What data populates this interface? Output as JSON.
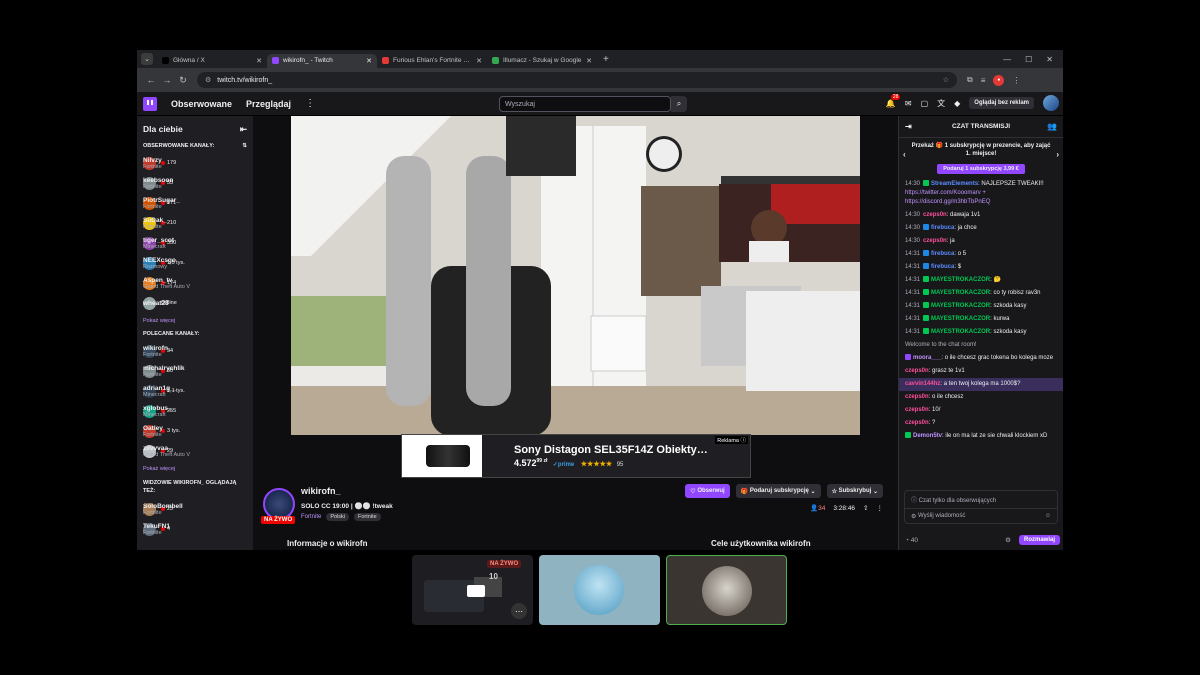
{
  "browser": {
    "tabs": [
      {
        "title": "Główna / X",
        "fav": "#000000",
        "active": false
      },
      {
        "title": "wikirofn_ - Twitch",
        "fav": "#9146ff",
        "active": true
      },
      {
        "title": "Furious Ehlan's Fortnite Stats -",
        "fav": "#e53935",
        "active": false
      },
      {
        "title": "Illumacz - Szukaj w Google",
        "fav": "#34a853",
        "active": false
      }
    ],
    "url": "twitch.tv/wikirofn_"
  },
  "nav": {
    "following": "Obserwowane",
    "browse": "Przeglądaj",
    "search_placeholder": "Wyszukaj",
    "notif_count": "28",
    "ad_free": "Oglądaj bez reklam"
  },
  "sidebar": {
    "title": "Dla ciebie",
    "followed_title": "OBSERWOWANE KANAŁY:",
    "followed": [
      {
        "name": "Nilvzy",
        "game": "Fortnite",
        "viewers": "179",
        "color": "#c0392b"
      },
      {
        "name": "keebsoon",
        "game": "Fortnite",
        "viewers": "55",
        "color": "#7f8c8d"
      },
      {
        "name": "PiotrSugar_",
        "game": "Fortnite",
        "viewers": "171",
        "color": "#d35400"
      },
      {
        "name": "SuDak_",
        "game": "Fortnite",
        "viewers": "210",
        "color": "#f1c40f"
      },
      {
        "name": "tiger_scot",
        "game": "Minecraft",
        "viewers": "350",
        "color": "#8e44ad"
      },
      {
        "name": "NEEXcsgo",
        "game": "Rozmowy",
        "viewers": "1,5 tys.",
        "color": "#2980b9"
      },
      {
        "name": "Aspen_tv_",
        "game": "Grand Theft Auto V",
        "viewers": "174",
        "color": "#e67e22"
      },
      {
        "name": "wheat28",
        "game": "",
        "viewers": "Offline",
        "color": "#95a5a6"
      }
    ],
    "show_more": "Pokaż więcej",
    "recommended_title": "POLECANE KANAŁY:",
    "recommended": [
      {
        "name": "wikirofn_",
        "game": "Fortnite",
        "viewers": "34",
        "color": "#34495e"
      },
      {
        "name": "michalrychlik",
        "game": "Fortnite",
        "viewers": "30",
        "color": "#7f8c8d"
      },
      {
        "name": "adrian1g__",
        "game": "Minecraft",
        "viewers": "1,1 tys.",
        "color": "#2c3e50"
      },
      {
        "name": "xglobus_",
        "game": "Minecraft",
        "viewers": "255",
        "color": "#16a085"
      },
      {
        "name": "Oatley",
        "game": "Fortnite",
        "viewers": "3 tys.",
        "color": "#c0392b"
      },
      {
        "name": "zilvvvaa",
        "game": "Grand Theft Auto V",
        "viewers": "29",
        "color": "#bdc3c7"
      }
    ],
    "show_more2": "Pokaż więcej",
    "viewers_title": "WIDZOWIE WIKIROFN_ OGLĄDAJĄ TEŻ:",
    "viewers_also": [
      {
        "name": "SoloBombell",
        "game": "Fortnite",
        "viewers": "25",
        "color": "#a67c52"
      },
      {
        "name": "TekuFN1",
        "game": "Fortnite",
        "viewers": "4",
        "color": "#5d6d7e"
      }
    ]
  },
  "ad": {
    "title": "Sony Distagon SEL35F14Z Obiekty…",
    "price": "4.572",
    "price_cents": "99 zł",
    "prime": "✓prime",
    "stars": "★★★★★",
    "reviews": "95",
    "label": "Reklama ⓘ"
  },
  "channel": {
    "name": "wikirofn_",
    "live": "NA ŻYWO",
    "title": "SOLO CC 19:00 | ⚪⚪ !tweak",
    "game": "Fortnite",
    "tags": [
      "Polski",
      "Fortnite"
    ],
    "follow": "Obserwuj",
    "gift": "Podaruj subskrypcję",
    "subscribe": "Subskrybuj",
    "viewers": "34",
    "uptime": "3:28:46",
    "about": "Informacje o wikirofn",
    "goals": "Cele użytkownika wikirofn"
  },
  "chat": {
    "header": "CZAT TRANSMISJI",
    "gift_text": "Przekaż 🎁 1 subskrypcję w prezencie, aby zająć 1. miejsce!",
    "gift_btn": "Podaruj 1 subskrypcję   3,99 €",
    "messages": [
      {
        "time": "14:30",
        "badge": "#00c853",
        "user": "StreamElements",
        "ucolor": "#5c8cff",
        "text": ": NAJLEPSZE TWEAKI!! ",
        "link": "https://twitter.com/Kooomarv + https://discord.gg/m3hbTbPnEQ"
      },
      {
        "time": "14:30",
        "badge": "",
        "user": "czeps0n",
        "ucolor": "#ff4f9a",
        "text": ": dawaja 1v1",
        "link": ""
      },
      {
        "time": "14:30",
        "badge": "#1e88e5",
        "user": "firebuca",
        "ucolor": "#5c8cff",
        "text": ": ja chce",
        "link": ""
      },
      {
        "time": "14:30",
        "badge": "",
        "user": "czeps0n",
        "ucolor": "#ff4f9a",
        "text": ": ja",
        "link": ""
      },
      {
        "time": "14:31",
        "badge": "#1e88e5",
        "user": "firebuca",
        "ucolor": "#5c8cff",
        "text": ": o 5",
        "link": ""
      },
      {
        "time": "14:31",
        "badge": "#1e88e5",
        "user": "firebuca",
        "ucolor": "#5c8cff",
        "text": ": $",
        "link": ""
      },
      {
        "time": "14:31",
        "badge": "#00c853",
        "user": "MAYESTROKACZOR",
        "ucolor": "#00c853",
        "text": ": 🤔",
        "link": ""
      },
      {
        "time": "14:31",
        "badge": "#00c853",
        "user": "MAYESTROKACZOR",
        "ucolor": "#00c853",
        "text": ": co ty robisz rav3n",
        "link": ""
      },
      {
        "time": "14:31",
        "badge": "#00c853",
        "user": "MAYESTROKACZOR",
        "ucolor": "#00c853",
        "text": ": szkoda kasy",
        "link": ""
      },
      {
        "time": "14:31",
        "badge": "#00c853",
        "user": "MAYESTROKACZOR",
        "ucolor": "#00c853",
        "text": ": kurwa",
        "link": ""
      },
      {
        "time": "14:31",
        "badge": "#00c853",
        "user": "MAYESTROKACZOR",
        "ucolor": "#00c853",
        "text": ": szkoda kasy",
        "link": ""
      },
      {
        "time": "",
        "badge": "",
        "user": "",
        "ucolor": "#adadb8",
        "text": "Welcome to the chat room!",
        "link": ""
      },
      {
        "time": "",
        "badge": "#9146ff",
        "user": "moora___",
        "ucolor": "#bf94ff",
        "text": ": o ile chcesz grac tokena bo kolega moze",
        "link": ""
      },
      {
        "time": "",
        "badge": "",
        "user": "czeps0n",
        "ucolor": "#ff4f9a",
        "text": ": grasz te 1v1",
        "link": ""
      },
      {
        "time": "",
        "badge": "",
        "user": "cavvin144hz",
        "ucolor": "#ff4f9a",
        "text": ": a ten twoj kolega ma 1000$?",
        "link": "",
        "hl": true
      },
      {
        "time": "",
        "badge": "",
        "user": "czeps0n",
        "ucolor": "#ff4f9a",
        "text": ": o ile chcesz",
        "link": ""
      },
      {
        "time": "",
        "badge": "",
        "user": "czeps0n",
        "ucolor": "#ff4f9a",
        "text": ": 10/",
        "link": ""
      },
      {
        "time": "",
        "badge": "",
        "user": "czeps0n",
        "ucolor": "#ff4f9a",
        "text": ": ?",
        "link": ""
      },
      {
        "time": "",
        "badge": "#00c853",
        "user": "Demon5tv",
        "ucolor": "#bf94ff",
        "text": ": ile on ma lat ze sie chwali klockiem xD",
        "link": ""
      }
    ],
    "followers_only": "Czat tylko dla obserwujących",
    "placeholder": "Wyślij wiadomość",
    "points": "40",
    "send": "Rozmawiaj"
  },
  "thumbs": {
    "live_label": "NA ŻYWO",
    "number": "10"
  }
}
